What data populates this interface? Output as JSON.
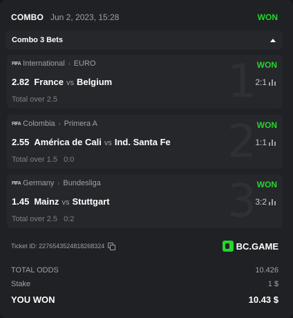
{
  "header": {
    "title": "COMBO",
    "datetime": "Jun 2, 2023, 15:28",
    "status": "WON"
  },
  "bets_bar": {
    "title": "Combo 3 Bets",
    "caret_icon": "caret-up-icon"
  },
  "bets": [
    {
      "index": "1",
      "sport": "FIFA",
      "country": "International",
      "league": "EURO",
      "result": "WON",
      "odds": "2.82",
      "home": "France",
      "vs": "vs",
      "away": "Belgium",
      "score": "2:1",
      "market": "Total over 2.5",
      "final_score": ""
    },
    {
      "index": "2",
      "sport": "FIFA",
      "country": "Colombia",
      "league": "Primera A",
      "result": "WON",
      "odds": "2.55",
      "home": "América de Cali",
      "vs": "vs",
      "away": "Ind. Santa Fe",
      "score": "1:1",
      "market": "Total over 1.5",
      "final_score": "0:0"
    },
    {
      "index": "3",
      "sport": "FIFA",
      "country": "Germany",
      "league": "Bundesliga",
      "result": "WON",
      "odds": "1.45",
      "home": "Mainz",
      "vs": "vs",
      "away": "Stuttgart",
      "score": "3:2",
      "market": "Total over 2.5",
      "final_score": "0:2"
    }
  ],
  "ticket": {
    "label": "Ticket ID: 2276543524818268324",
    "copy_icon": "copy-icon"
  },
  "brand": {
    "name": "BC.GAME"
  },
  "summary": {
    "total_odds_label": "TOTAL ODDS",
    "total_odds_value": "10.426",
    "stake_label": "Stake",
    "stake_value": "1 $",
    "won_label": "YOU WON",
    "won_value": "10.43 $"
  },
  "colors": {
    "background": "#202124",
    "panel": "#26272b",
    "accent_green": "#25d62b",
    "muted_text": "#9ea2a8"
  }
}
